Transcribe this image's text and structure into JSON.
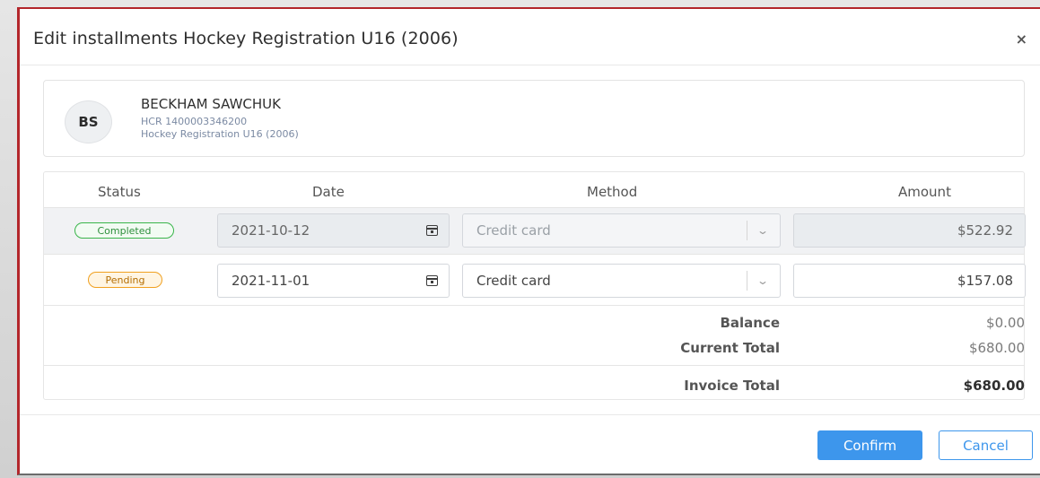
{
  "modal": {
    "title": "Edit installments Hockey Registration U16 (2006)",
    "close_label": "×"
  },
  "patient": {
    "initials": "BS",
    "name": "BECKHAM SAWCHUK",
    "account": "HCR 1400003346200",
    "program": "Hockey Registration U16 (2006)"
  },
  "table": {
    "headers": {
      "status": "Status",
      "date": "Date",
      "method": "Method",
      "amount": "Amount"
    },
    "rows": [
      {
        "status": "Completed",
        "date": "2021-10-12",
        "method": "Credit card",
        "amount": "$522.92"
      },
      {
        "status": "Pending",
        "date": "2021-11-01",
        "method": "Credit card",
        "amount": "$157.08"
      }
    ]
  },
  "summary": {
    "balance_label": "Balance",
    "balance_value": "$0.00",
    "current_total_label": "Current Total",
    "current_total_value": "$680.00",
    "invoice_total_label": "Invoice Total",
    "invoice_total_value": "$680.00"
  },
  "buttons": {
    "confirm": "Confirm",
    "cancel": "Cancel"
  },
  "colors": {
    "primary": "#3d96ec",
    "completed": "#39b54a",
    "pending": "#f0a020"
  }
}
